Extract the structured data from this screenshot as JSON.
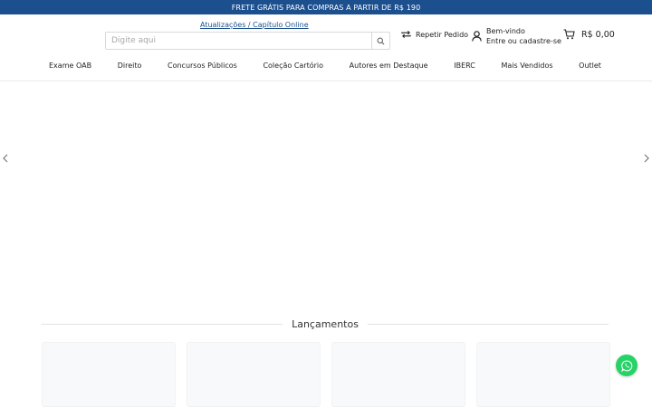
{
  "topbar": {
    "text": "FRETE GRÁTIS PARA COMPRAS A PARTIR DE R$ 190"
  },
  "header": {
    "updates_link": "Atualizações / Capítulo Online",
    "search": {
      "placeholder": "Digite aqui",
      "value": ""
    },
    "repeat_order": "Repetir Pedido",
    "account": {
      "greeting": "Bem-vindo",
      "action": "Entre ou cadastre-se"
    },
    "cart_total": "R$ 0,00"
  },
  "nav": {
    "items": [
      "Exame OAB",
      "Direito",
      "Concursos Públicos",
      "Coleção Cartório",
      "Autores em Destaque",
      "IBERC",
      "Mais Vendidos",
      "Outlet"
    ]
  },
  "main": {
    "section_title": "Lançamentos"
  },
  "colors": {
    "brand": "#1c4f8e",
    "whatsapp": "#25d366"
  },
  "icons": [
    "search-icon",
    "repeat-icon",
    "user-icon",
    "cart-icon",
    "chevron-left-icon",
    "chevron-right-icon",
    "whatsapp-icon"
  ]
}
